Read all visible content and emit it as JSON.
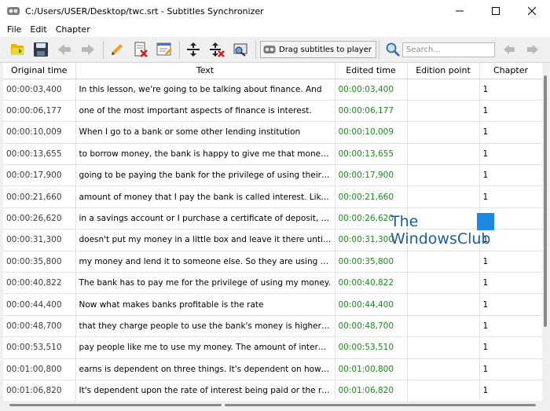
{
  "window": {
    "title": "C:/Users/USER/Desktop/twc.srt - Subtitles Synchronizer"
  },
  "menu": [
    "File",
    "Edit",
    "Chapter"
  ],
  "toolbar": {
    "drag_label": "Drag subtitles to player",
    "search_placeholder": "Search...",
    "icons": [
      "open-file-icon",
      "save-icon",
      "back-arrow-icon",
      "forward-arrow-icon",
      "pencil-icon",
      "delete-page-icon",
      "edit-note-icon",
      "split-icon",
      "remove-split-icon",
      "preview-icon",
      "search-icon",
      "previous-result-icon",
      "next-result-icon"
    ]
  },
  "table": {
    "columns": [
      "Original time",
      "Text",
      "Edited time",
      "Edition point",
      "Chapter"
    ],
    "rows": [
      {
        "orig": "00:00:03,400",
        "text": "In this lesson, we're going to be talking about finance. And",
        "edited": "00:00:03,400",
        "point": "",
        "chapter": "1"
      },
      {
        "orig": "00:00:06,177",
        "text": "one of the most important aspects of finance is interest.",
        "edited": "00:00:06,177",
        "point": "",
        "chapter": "1"
      },
      {
        "orig": "00:00:10,009",
        "text": "When I go to a bank or some other lending institution",
        "edited": "00:00:10,009",
        "point": "",
        "chapter": "1"
      },
      {
        "orig": "00:00:13,655",
        "text": "to borrow money, the bank is happy to give me that money. But ...",
        "edited": "00:00:13,655",
        "point": "",
        "chapter": "1"
      },
      {
        "orig": "00:00:17,900",
        "text": "going to be paying the bank for the privilege of using their mone...",
        "edited": "00:00:17,900",
        "point": "",
        "chapter": "1"
      },
      {
        "orig": "00:00:21,660",
        "text": "amount of money that I pay the bank is called interest. Likewise, i...",
        "edited": "00:00:21,660",
        "point": "",
        "chapter": "1"
      },
      {
        "orig": "00:00:26,620",
        "text": "in a savings account or I purchase a certificate of deposit, the ba...",
        "edited": "00:00:26,620",
        "point": "",
        "chapter": "1"
      },
      {
        "orig": "00:00:31,300",
        "text": "doesn't put my money in a little box and leave it there until later. ...",
        "edited": "00:00:31,300",
        "point": "",
        "chapter": "1"
      },
      {
        "orig": "00:00:35,800",
        "text": "my money and lend it to someone else. So they are using my mo...",
        "edited": "00:00:35,800",
        "point": "",
        "chapter": "1"
      },
      {
        "orig": "00:00:40,822",
        "text": "The bank has to pay me for the privilege of using my money.",
        "edited": "00:00:40,822",
        "point": "",
        "chapter": "1"
      },
      {
        "orig": "00:00:44,400",
        "text": "Now what makes banks profitable is the rate",
        "edited": "00:00:44,400",
        "point": "",
        "chapter": "1"
      },
      {
        "orig": "00:00:48,700",
        "text": "that they charge people to use the bank's money is higher than t...",
        "edited": "00:00:48,700",
        "point": "",
        "chapter": "1"
      },
      {
        "orig": "00:00:53,510",
        "text": "pay people like me to use my money. The amount of interest tha...",
        "edited": "00:00:53,510",
        "point": "",
        "chapter": "1"
      },
      {
        "orig": "00:01:00,800",
        "text": "earns is dependent on three things. It's dependent on how much ...",
        "edited": "00:01:00,800",
        "point": "",
        "chapter": "1"
      },
      {
        "orig": "00:01:06,820",
        "text": "It's dependent upon the rate of interest being paid or the rate of i...",
        "edited": "00:01:06,820",
        "point": "",
        "chapter": "1"
      }
    ]
  },
  "watermark": {
    "line1": "The",
    "line2": "WindowsClub"
  },
  "colors": {
    "edited_time": "#1f8a1f",
    "watermark": "#1b5e9c"
  }
}
